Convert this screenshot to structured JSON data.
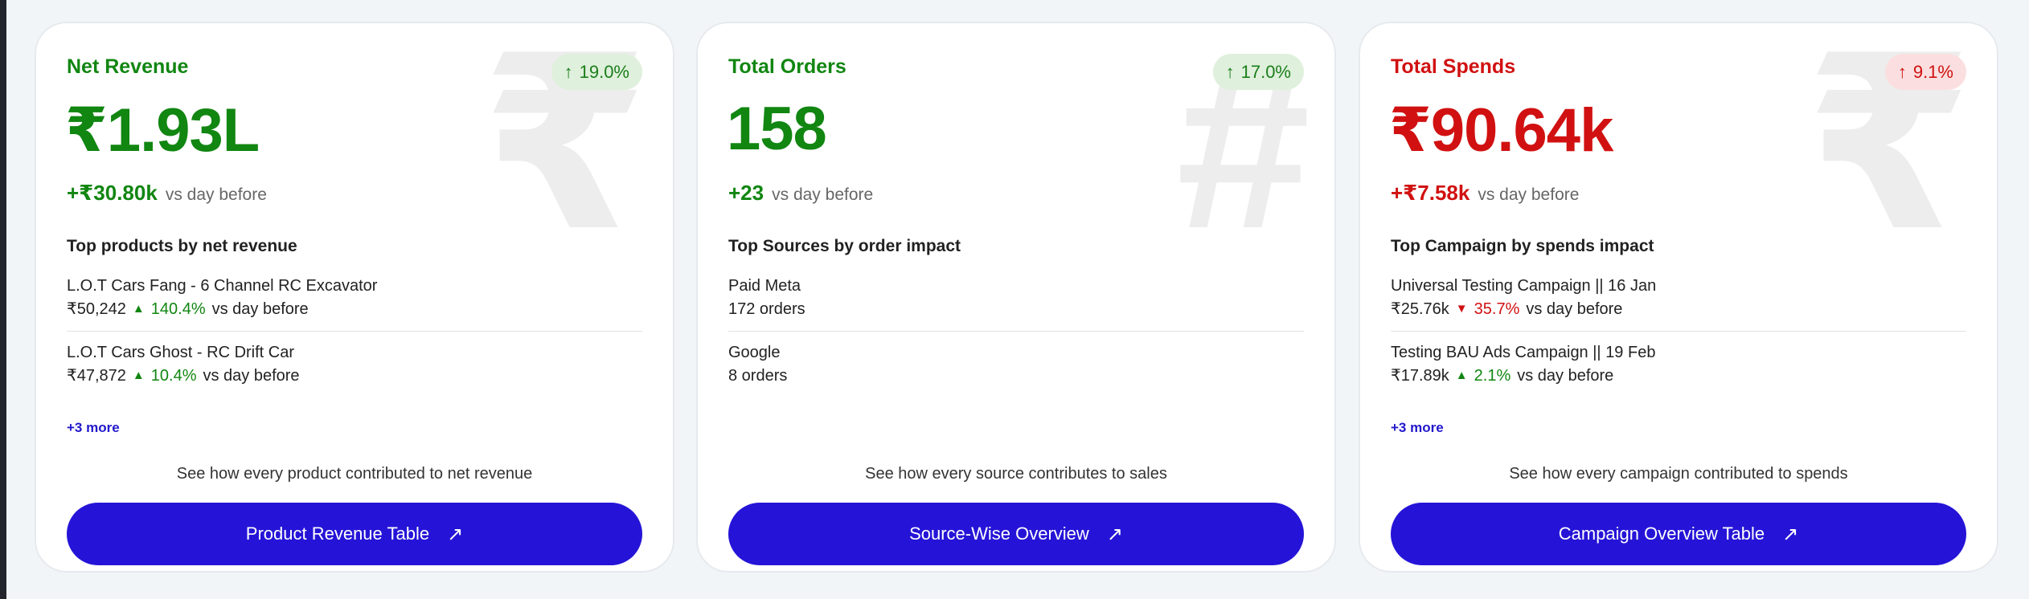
{
  "cards": [
    {
      "title": "Net Revenue",
      "badge": "19.0%",
      "badge_arrow": "↑",
      "bg_symbol": "₹",
      "value": "₹1.93L",
      "delta": "+₹30.80k",
      "delta_suffix": "vs day before",
      "section_title": "Top products by net revenue",
      "items": [
        {
          "name": "L.O.T Cars Fang - 6 Channel RC Excavator",
          "value": "₹50,242",
          "trend": "▲",
          "pct": "140.4%",
          "suffix": "vs day before"
        },
        {
          "name": "L.O.T Cars Ghost - RC Drift Car",
          "value": "₹47,872",
          "trend": "▲",
          "pct": "10.4%",
          "suffix": "vs day before"
        }
      ],
      "more": "+3 more",
      "caption": "See how every product contributed to net revenue",
      "cta": "Product Revenue Table",
      "cta_icon": "↗"
    },
    {
      "title": "Total Orders",
      "badge": "17.0%",
      "badge_arrow": "↑",
      "bg_symbol": "#",
      "value": "158",
      "delta": "+23",
      "delta_suffix": "vs day before",
      "section_title": "Top Sources by order impact",
      "items": [
        {
          "name": "Paid Meta",
          "value": "172 orders"
        },
        {
          "name": "Google",
          "value": "8 orders"
        }
      ],
      "caption": "See how every source contributes to sales",
      "cta": "Source-Wise Overview",
      "cta_icon": "↗"
    },
    {
      "title": "Total Spends",
      "badge": "9.1%",
      "badge_arrow": "↑",
      "bg_symbol": "₹",
      "value": "₹90.64k",
      "delta": "+₹7.58k",
      "delta_suffix": "vs day before",
      "section_title": "Top Campaign by spends impact",
      "items": [
        {
          "name": "Universal Testing Campaign || 16 Jan",
          "value": "₹25.76k",
          "trend": "▼",
          "pct": "35.7%",
          "suffix": "vs day before"
        },
        {
          "name": "Testing BAU Ads Campaign || 19 Feb",
          "value": "₹17.89k",
          "trend": "▲",
          "pct": "2.1%",
          "suffix": "vs day before"
        }
      ],
      "more": "+3 more",
      "caption": "See how every campaign contributed to spends",
      "cta": "Campaign Overview Table",
      "cta_icon": "↗"
    }
  ],
  "colors": {
    "positive": "#118611",
    "negative": "#d11111",
    "primary": "#2514d7",
    "link": "#2218cc"
  }
}
